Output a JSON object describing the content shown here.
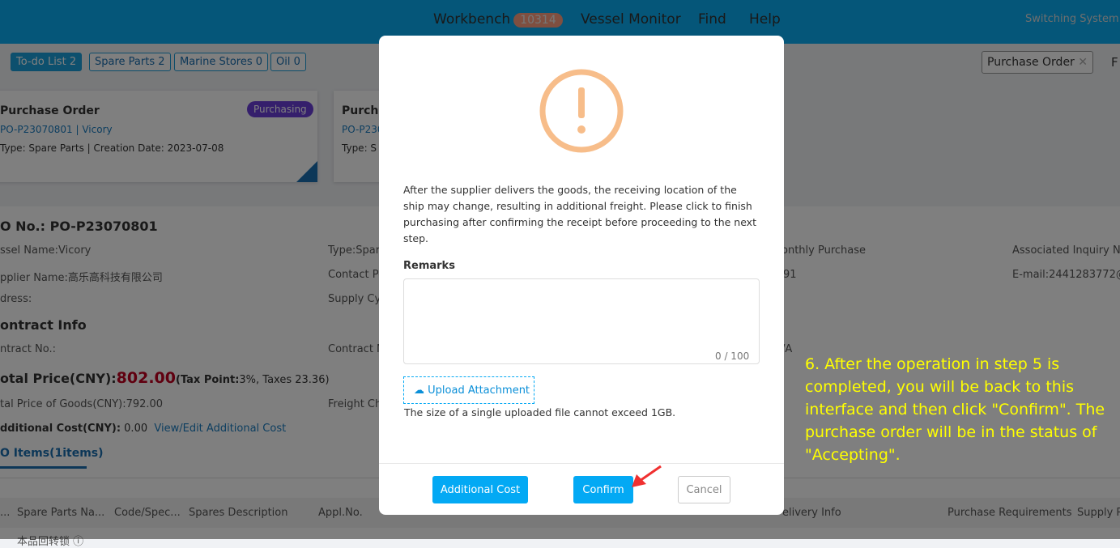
{
  "header": {
    "nav": [
      {
        "label": "Workbench",
        "badge": "10314"
      },
      {
        "label": "Vessel Monitor"
      },
      {
        "label": "Find"
      },
      {
        "label": "Help"
      }
    ],
    "switch_system": "Switching System ▾"
  },
  "tabs": [
    "To-do List 2",
    "Spare Parts 2",
    "Marine Stores 0",
    "Oil 0"
  ],
  "filter_tag": "Purchase Order",
  "filter_more": "F",
  "cards": [
    {
      "title": "Purchase Order",
      "status": "Purchasing",
      "po": "PO-P23070801",
      "sep": " | ",
      "vessel": "Vicory",
      "meta": "Type:  Spare Parts | Creation Date:  2023-07-08"
    },
    {
      "title": "Purcha",
      "po": "PO-P230",
      "meta": "Type:  S"
    }
  ],
  "detail": {
    "po_no": "O No.:  PO-P23070801",
    "vessel": "ssel Name:Vicory",
    "type": "Type:Spar",
    "monthly": "onthly Purchase",
    "inquiry": "Associated Inquiry No",
    "supplier": "pplier Name:高乐高科技有限公司",
    "contact": "Contact Pe",
    "phone": "91",
    "email": "E-mail:2441283772@",
    "address": "dress:",
    "supply": "Supply Cy",
    "contract_title": "ontract Info",
    "contract_no": "ntract No.:",
    "contract_n": "Contract N",
    "va": "/A",
    "total_label": "otal Price(CNY):",
    "total_value": "802.00",
    "tax_label": "(Tax Point:",
    "tax_value": "3%, Taxes 23.36)",
    "goods": "tal Price of Goods(CNY):792.00",
    "freight": "Freight Ch",
    "add_label": "dditional Cost(CNY):",
    "add_value": " 0.00",
    "add_link": "View/Edit Additional Cost",
    "items_tab": "O Items(1items)",
    "columns": [
      "...",
      "Spare Parts Na...",
      "Code/Spec...",
      "Spares Description",
      "Appl.No.",
      "elivery Info",
      "Purchase Requirements",
      "Supply R"
    ],
    "row_first": "本品回转锁 ⓘ"
  },
  "modal": {
    "icon": "warning-icon",
    "icon_color": "#f7bd8a",
    "message": "After the supplier delivers the goods, the receiving location of the ship may change, resulting in additional freight. Please click to finish purchasing after confirming the receipt before proceeding to the next step.",
    "remarks_label": "Remarks",
    "remarks_value": "",
    "counter": "0 / 100",
    "upload_label": "Upload Attachment",
    "upload_hint": "The size of a single uploaded file cannot exceed 1GB.",
    "buttons": {
      "additional": "Additional Cost",
      "confirm": "Confirm",
      "cancel": "Cancel"
    }
  },
  "annotation": "6. After the operation in step 5 is completed, you will be back to this interface and then click \"Confirm\". The purchase order will be in the status of \"Accepting\"."
}
